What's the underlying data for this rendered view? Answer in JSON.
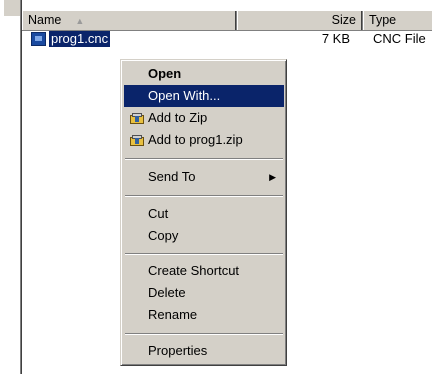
{
  "header": {
    "name": "Name",
    "size": "Size",
    "type": "Type"
  },
  "file": {
    "name": "prog1.cnc",
    "size": "7 KB",
    "type": "CNC File"
  },
  "context_menu": {
    "items": [
      {
        "label": "Open"
      },
      {
        "label": "Open With..."
      },
      {
        "label": "Add to Zip"
      },
      {
        "label": "Add to prog1.zip"
      },
      {
        "label": "Send To"
      },
      {
        "label": "Cut"
      },
      {
        "label": "Copy"
      },
      {
        "label": "Create Shortcut"
      },
      {
        "label": "Delete"
      },
      {
        "label": "Rename"
      },
      {
        "label": "Properties"
      }
    ]
  },
  "icons": {
    "file": "cnc-file-icon",
    "zip": "zip-archive-icon",
    "submenu": "submenu-arrow-icon",
    "sort": "sort-ascending-icon"
  },
  "colors": {
    "selection": "#0a246a",
    "menu_bg": "#d4d0c8",
    "header_bg": "#d4d0c8"
  }
}
